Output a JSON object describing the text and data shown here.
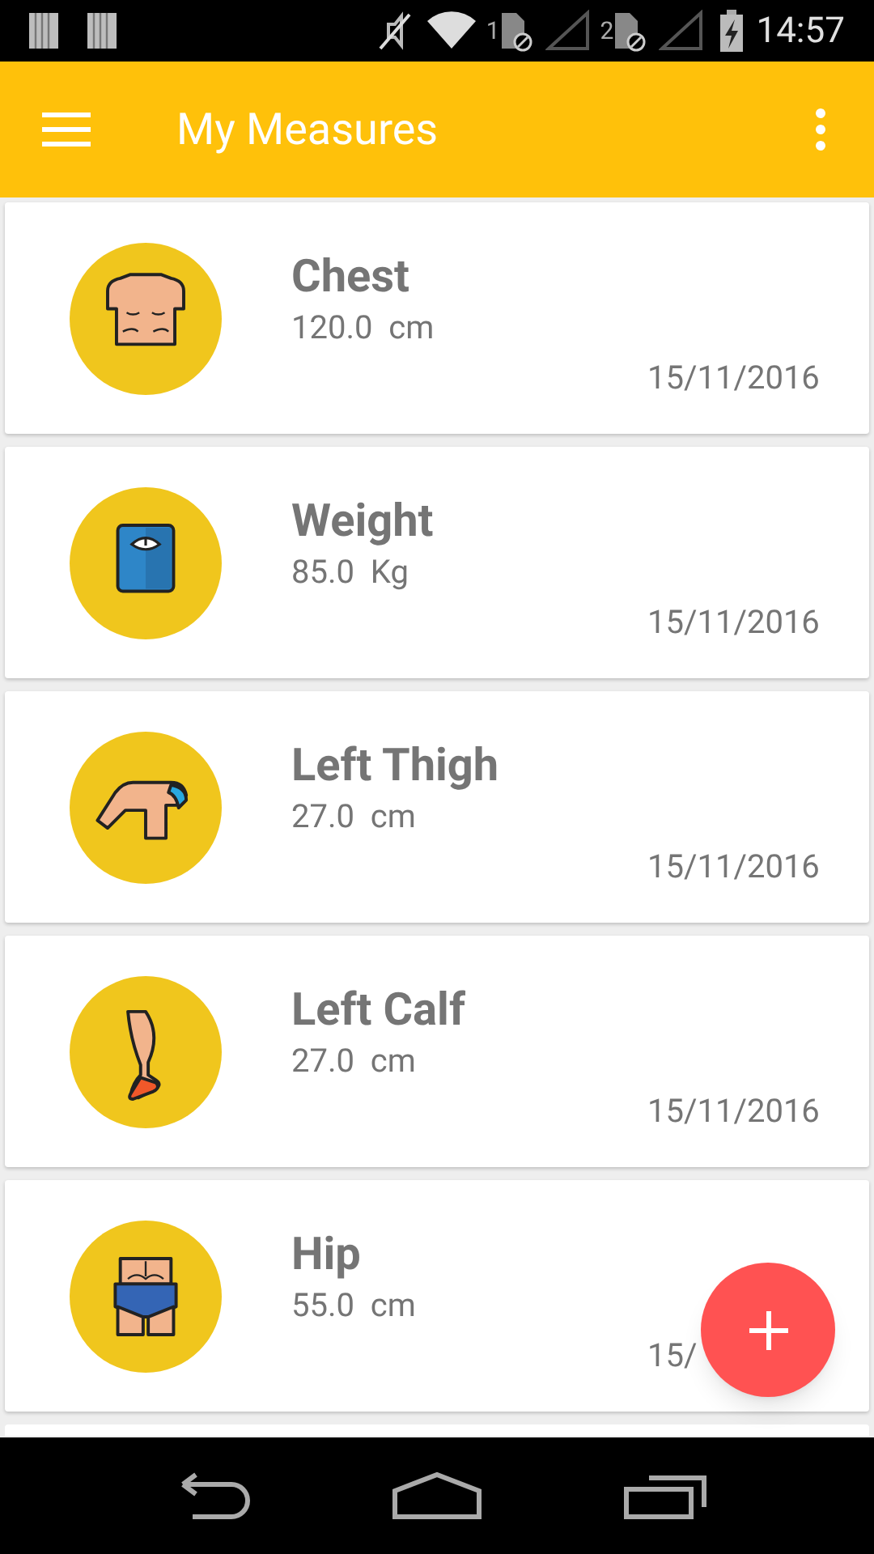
{
  "status_bar": {
    "sim_1_label": "1",
    "sim_2_label": "2",
    "time": "14:57"
  },
  "app_bar": {
    "title": "My Measures"
  },
  "measures": [
    {
      "kind": "chest",
      "name": "Chest",
      "value": "120.0  cm",
      "date": "15/11/2016"
    },
    {
      "kind": "scale",
      "name": "Weight",
      "value": "85.0  Kg",
      "date": "15/11/2016"
    },
    {
      "kind": "thigh",
      "name": "Left Thigh",
      "value": "27.0  cm",
      "date": "15/11/2016"
    },
    {
      "kind": "calf",
      "name": "Left Calf",
      "value": "27.0  cm",
      "date": "15/11/2016"
    },
    {
      "kind": "hip",
      "name": "Hip",
      "value": "55.0  cm",
      "date": "15/"
    }
  ]
}
